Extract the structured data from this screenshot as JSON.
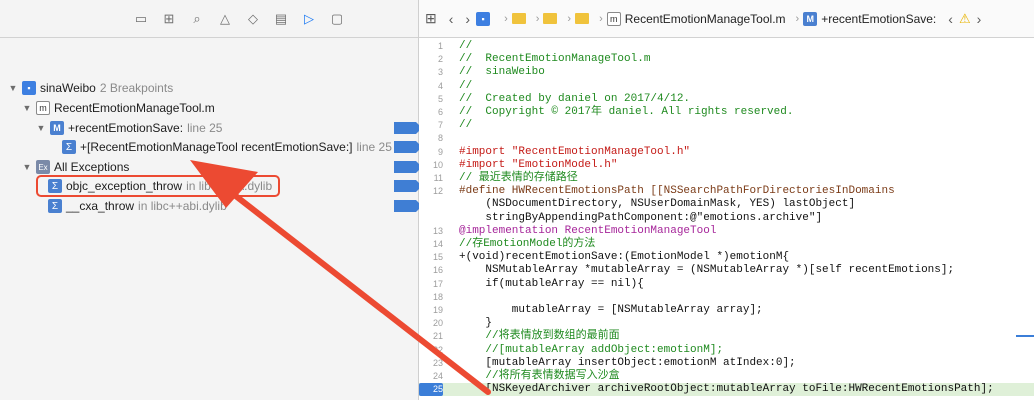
{
  "nav_toolbar": {
    "icons": [
      "folder-icon",
      "source-control-icon",
      "search-icon",
      "warning-icon",
      "test-icon",
      "debug-icon",
      "breakpoint-navigator-icon",
      "report-icon"
    ]
  },
  "tree": {
    "project": {
      "name": "sinaWeibo",
      "detail": "2 Breakpoints"
    },
    "file": {
      "name": "RecentEmotionManageTool.m"
    },
    "method": {
      "name": "+recentEmotionSave:",
      "detail": "line 25"
    },
    "method_bp": {
      "name": "+[RecentEmotionManageTool recentEmotionSave:]",
      "detail": "line 25"
    },
    "exceptions": {
      "name": "All Exceptions"
    },
    "frame1": {
      "name": "objc_exception_throw",
      "detail": "in libobjc.A.dylib"
    },
    "frame2": {
      "name": "__cxa_throw",
      "detail": "in libc++abi.dylib"
    }
  },
  "jumpbar": {
    "file": "RecentEmotionManageTool.m",
    "method": "+recentEmotionSave:",
    "method_badge": "M"
  },
  "code": [
    {
      "n": "1",
      "t": "//"
    },
    {
      "n": "2",
      "t": "//  RecentEmotionManageTool.m"
    },
    {
      "n": "3",
      "t": "//  sinaWeibo"
    },
    {
      "n": "4",
      "t": "//"
    },
    {
      "n": "5",
      "t": "//  Created by daniel on 2017/4/12."
    },
    {
      "n": "6",
      "t": "//  Copyright © 2017年 daniel. All rights reserved."
    },
    {
      "n": "7",
      "t": "//"
    },
    {
      "n": "8",
      "t": ""
    },
    {
      "n": "9",
      "t": "#import \"RecentEmotionManageTool.h\""
    },
    {
      "n": "10",
      "t": "#import \"EmotionModel.h\""
    },
    {
      "n": "11",
      "t": "// 最近表情的存储路径"
    },
    {
      "n": "12",
      "t": "#define HWRecentEmotionsPath [[NSSearchPathForDirectoriesInDomains"
    },
    {
      "n": "",
      "t": "    (NSDocumentDirectory, NSUserDomainMask, YES) lastObject]"
    },
    {
      "n": "",
      "t": "    stringByAppendingPathComponent:@\"emotions.archive\"]"
    },
    {
      "n": "13",
      "t": "@implementation RecentEmotionManageTool"
    },
    {
      "n": "14",
      "t": "//存EmotionModel的方法"
    },
    {
      "n": "15",
      "t": "+(void)recentEmotionSave:(EmotionModel *)emotionM{"
    },
    {
      "n": "16",
      "t": "    NSMutableArray *mutableArray = (NSMutableArray *)[self recentEmotions];"
    },
    {
      "n": "17",
      "t": "    if(mutableArray == nil){"
    },
    {
      "n": "18",
      "t": ""
    },
    {
      "n": "19",
      "t": "        mutableArray = [NSMutableArray array];"
    },
    {
      "n": "20",
      "t": "    }"
    },
    {
      "n": "21",
      "t": "    //将表情放到数组的最前面"
    },
    {
      "n": "22",
      "t": "    //[mutableArray addObject:emotionM];"
    },
    {
      "n": "23",
      "t": "    [mutableArray insertObject:emotionM atIndex:0];"
    },
    {
      "n": "24",
      "t": "    //将所有表情数据写入沙盒"
    },
    {
      "n": "25",
      "t": "    [NSKeyedArchiver archiveRootObject:mutableArray toFile:HWRecentEmotionsPath];"
    }
  ],
  "colors": {
    "accent": "#3b7ed8",
    "annotation": "#ec4a32",
    "comment": "#1f8a1f",
    "string": "#c41a16"
  }
}
